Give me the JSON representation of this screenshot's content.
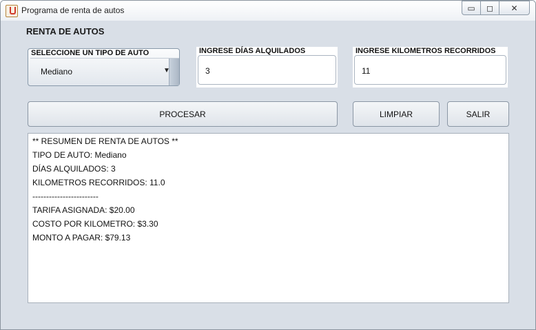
{
  "window": {
    "title": "Programa de renta de autos",
    "controls": {
      "minimize": "▭",
      "restore": "◻",
      "close": "✕"
    }
  },
  "panel": {
    "title": "RENTA DE AUTOS"
  },
  "car_type": {
    "label": "SELECCIONE UN TIPO DE AUTO",
    "selected": "Mediano"
  },
  "days": {
    "label": "INGRESE DÍAS ALQUILADOS",
    "value": "3"
  },
  "km": {
    "label": "INGRESE KILOMETROS RECORRIDOS",
    "value": "11"
  },
  "buttons": {
    "process": "PROCESAR",
    "clear": "LIMPIAR",
    "exit": "SALIR"
  },
  "summary": {
    "lines": [
      "** RESUMEN DE RENTA DE AUTOS **",
      "TIPO DE AUTO: Mediano",
      "DÍAS ALQUILADOS: 3",
      "KILOMETROS RECORRIDOS: 11.0",
      "------------------------",
      "TARIFA ASIGNADA: $20.00",
      "COSTO POR KILOMETRO: $3.30",
      "MONTO A PAGAR: $79.13"
    ]
  }
}
